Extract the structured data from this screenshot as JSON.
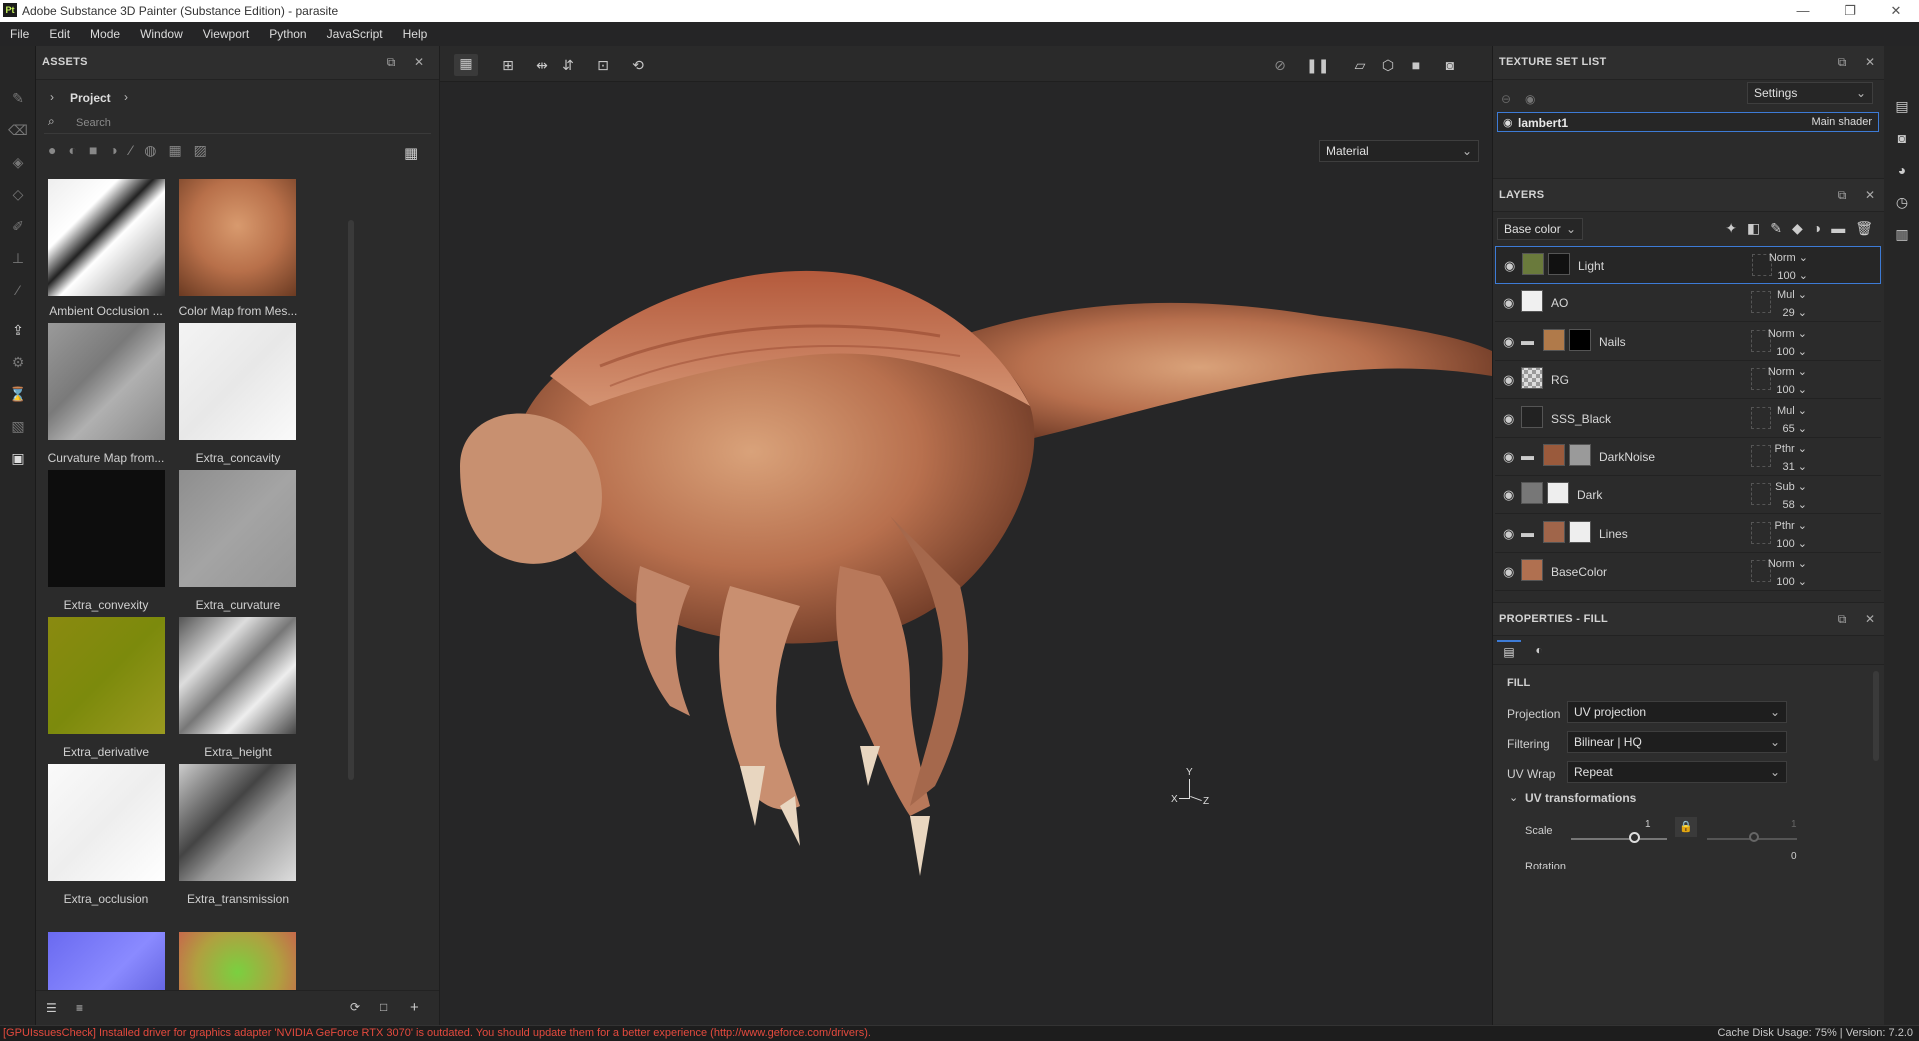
{
  "window": {
    "title": "Adobe Substance 3D Painter (Substance Edition) - parasite",
    "app_badge": "Pt",
    "controls": [
      "—",
      "❐",
      "✕"
    ]
  },
  "menu": [
    "File",
    "Edit",
    "Mode",
    "Window",
    "Viewport",
    "Python",
    "JavaScript",
    "Help"
  ],
  "assets": {
    "title": "ASSETS",
    "breadcrumb": "Project",
    "search_placeholder": "Search",
    "items": [
      {
        "label": "Ambient Occlusion ...",
        "style": "ao"
      },
      {
        "label": "Color Map from Mes...",
        "style": "color"
      },
      {
        "label": "Curvature Map from...",
        "style": "curv"
      },
      {
        "label": "Extra_concavity",
        "style": "white"
      },
      {
        "label": "Extra_convexity",
        "style": "black"
      },
      {
        "label": "Extra_curvature",
        "style": "gray"
      },
      {
        "label": "Extra_derivative",
        "style": "olive"
      },
      {
        "label": "Extra_height",
        "style": "height"
      },
      {
        "label": "Extra_occlusion",
        "style": "white2"
      },
      {
        "label": "Extra_transmission",
        "style": "trans"
      },
      {
        "label": "",
        "style": "normal"
      },
      {
        "label": "",
        "style": "position"
      }
    ]
  },
  "viewport": {
    "mode_select": "Material",
    "axis": {
      "x": "X",
      "y": "Y",
      "z": "Z"
    }
  },
  "texture_set_list": {
    "title": "TEXTURE SET LIST",
    "settings_label": "Settings",
    "items": [
      {
        "name": "lambert1",
        "shader": "Main shader"
      }
    ]
  },
  "layers": {
    "title": "LAYERS",
    "channel": "Base color",
    "rows": [
      {
        "name": "Light",
        "blend": "Norm",
        "opacity": "100",
        "folder": false,
        "thumb": "#6a7a3c",
        "mask": "#111111",
        "selected": true
      },
      {
        "name": "AO",
        "blend": "Mul",
        "opacity": "29",
        "folder": false,
        "thumb": "#f0f0f0",
        "mask": "",
        "selected": false
      },
      {
        "name": "Nails",
        "blend": "Norm",
        "opacity": "100",
        "folder": true,
        "thumb": "#b07a4a",
        "mask": "#000000",
        "selected": false
      },
      {
        "name": "RG",
        "blend": "Norm",
        "opacity": "100",
        "folder": false,
        "thumb": "checker",
        "mask": "",
        "selected": false
      },
      {
        "name": "SSS_Black",
        "blend": "Mul",
        "opacity": "65",
        "folder": false,
        "thumb": "#222222",
        "mask": "",
        "selected": false
      },
      {
        "name": "DarkNoise",
        "blend": "Pthr",
        "opacity": "31",
        "folder": true,
        "thumb": "#9a5a3c",
        "mask": "#9a9a9a",
        "selected": false
      },
      {
        "name": "Dark",
        "blend": "Sub",
        "opacity": "58",
        "folder": false,
        "thumb": "#777777",
        "mask": "#eeeeee",
        "selected": false
      },
      {
        "name": "Lines",
        "blend": "Pthr",
        "opacity": "100",
        "folder": true,
        "thumb": "#a0654a",
        "mask": "#eeeeee",
        "selected": false
      },
      {
        "name": "BaseColor",
        "blend": "Norm",
        "opacity": "100",
        "folder": false,
        "thumb": "#b07050",
        "mask": "",
        "selected": false
      }
    ]
  },
  "properties": {
    "title": "PROPERTIES - FILL",
    "section": "FILL",
    "fields": [
      {
        "label": "Projection",
        "value": "UV projection"
      },
      {
        "label": "Filtering",
        "value": "Bilinear | HQ"
      },
      {
        "label": "UV Wrap",
        "value": "Repeat"
      }
    ],
    "uv_section": "UV transformations",
    "scale_label": "Scale",
    "scale_value": "1",
    "scale_value2": "1",
    "rotation_label": "Rotation",
    "rotation_value": "0"
  },
  "status": {
    "message": "[GPUIssuesCheck] Installed driver for graphics adapter 'NVIDIA GeForce RTX 3070' is outdated. You should update them for a better experience (http://www.geforce.com/drivers).",
    "cache": "Cache Disk Usage:",
    "usage": "75%",
    "version": "Version: 7.2.0"
  },
  "colors": {
    "accent": "#3d7bd6",
    "status_error": "#e44a3e",
    "layer_orange": "#e07a2a"
  }
}
